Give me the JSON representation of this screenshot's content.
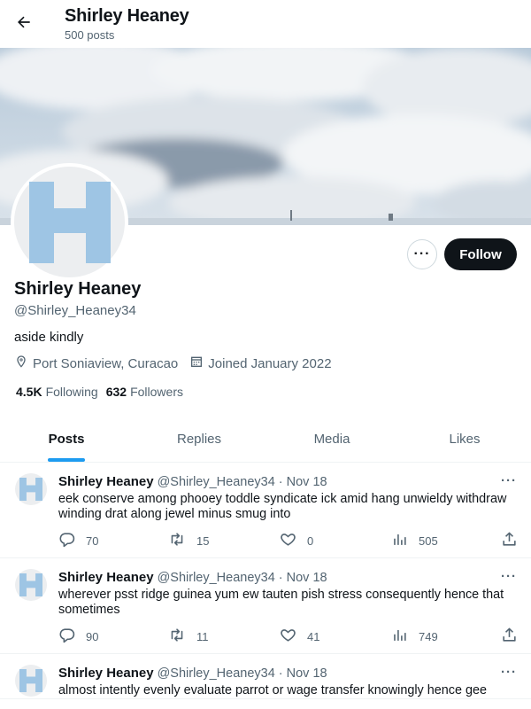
{
  "header": {
    "title": "Shirley Heaney",
    "post_count": "500 posts"
  },
  "profile": {
    "name": "Shirley Heaney",
    "handle": "@Shirley_Heaney34",
    "bio": "aside kindly",
    "location": "Port Soniaview, Curacao",
    "joined": "Joined January 2022",
    "following_count": "4.5K",
    "following_label": "Following",
    "followers_count": "632",
    "followers_label": "Followers",
    "follow_label": "Follow",
    "more_label": "···"
  },
  "tabs": [
    {
      "label": "Posts"
    },
    {
      "label": "Replies"
    },
    {
      "label": "Media"
    },
    {
      "label": "Likes"
    }
  ],
  "posts": [
    {
      "name": "Shirley Heaney",
      "handle": "@Shirley_Heaney34",
      "dot": "·",
      "date": "Nov 18",
      "text": "eek conserve among phooey toddle syndicate ick amid hang unwieldy withdraw winding drat along jewel minus smug into",
      "replies": "70",
      "reposts": "15",
      "likes": "0",
      "views": "505",
      "menu": "···"
    },
    {
      "name": "Shirley Heaney",
      "handle": "@Shirley_Heaney34",
      "dot": "·",
      "date": "Nov 18",
      "text": "wherever psst ridge guinea yum ew tauten pish stress consequently hence that sometimes",
      "replies": "90",
      "reposts": "11",
      "likes": "41",
      "views": "749",
      "menu": "···"
    },
    {
      "name": "Shirley Heaney",
      "handle": "@Shirley_Heaney34",
      "dot": "·",
      "date": "Nov 18",
      "text": "almost intently evenly evaluate parrot or wage transfer knowingly hence gee",
      "replies": "",
      "reposts": "",
      "likes": "",
      "views": "",
      "menu": "···"
    }
  ],
  "colors": {
    "accent": "#1d9bf0",
    "avatar_logo": "#9ec5e4",
    "text_secondary": "#536471"
  },
  "icons": [
    "back-arrow-icon",
    "location-pin-icon",
    "calendar-icon",
    "reply-icon",
    "repost-icon",
    "like-icon",
    "views-icon",
    "share-icon"
  ]
}
